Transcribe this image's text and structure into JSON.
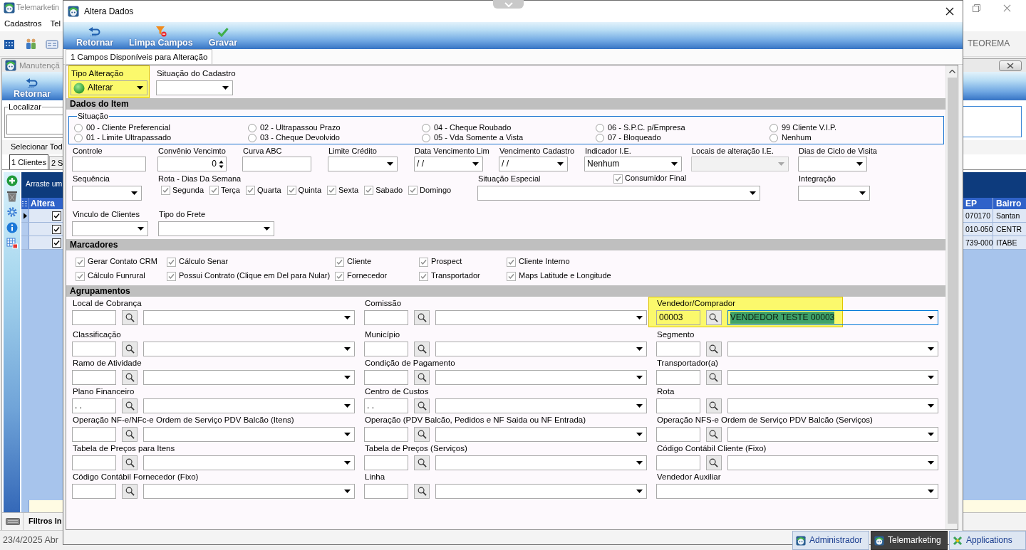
{
  "main_window": {
    "title": "Telemarketin",
    "menu": [
      "Cadastros",
      "Tel"
    ],
    "brand": "TEOREMA"
  },
  "child_window": {
    "title": "Manutençã",
    "toolbar": [
      "Retornar"
    ],
    "search_legend": "Localizar",
    "select_all": "Selecionar Tod",
    "tabs": [
      {
        "label": "1 Clientes",
        "selected": true
      },
      {
        "label": "2 S",
        "selected": false
      }
    ],
    "grid": {
      "group_hint": "Arraste um",
      "check_column": "Altera",
      "columns": [
        "EP",
        "Bairro"
      ],
      "rows": [
        {
          "current": true,
          "altera": true,
          "cells": [
            "070170",
            "Santan"
          ]
        },
        {
          "current": false,
          "altera": true,
          "cells": [
            "010-050",
            "CENTR"
          ]
        },
        {
          "current": false,
          "altera": true,
          "cells": [
            "739-000",
            "ITABE"
          ]
        }
      ]
    },
    "filter_bar": "Filtros In",
    "status": "23/4/2025 Abr"
  },
  "dialog": {
    "title": "Altera Dados",
    "toolbar": [
      "Retornar",
      "Limpa Campos",
      "Gravar"
    ],
    "tabs": [
      {
        "label": "1 Campos Disponíveis para Alteração",
        "selected": true
      }
    ],
    "top_fields": [
      {
        "label": "Tipo Alteração",
        "kind": "status-combo",
        "value": "Alterar",
        "highlighted": true
      },
      {
        "label": "Situação do Cadastro",
        "kind": "combo",
        "highlighted": false
      }
    ],
    "item_section": {
      "header": "Dados do Item",
      "situacao": {
        "legend": "Situação",
        "options": [
          {
            "label": "00 - Cliente Preferencial",
            "selected": false
          },
          {
            "label": "02 - Ultrapassou Prazo",
            "selected": false
          },
          {
            "label": "04 - Cheque Roubado",
            "selected": false
          },
          {
            "label": "06 - S.P.C. p/Empresa",
            "selected": false
          },
          {
            "label": "99 Cliente V.I.P.",
            "selected": false
          },
          {
            "label": "01 - Limite Ultrapassado",
            "selected": false
          },
          {
            "label": "03 - Cheque Devolvido",
            "selected": false
          },
          {
            "label": "05 - Vda Somente a Vista",
            "selected": false
          },
          {
            "label": "07 - Bloqueado",
            "selected": false
          },
          {
            "label": "Nenhum",
            "selected": false
          }
        ]
      },
      "row_1": [
        {
          "label": "Controle",
          "kind": "text"
        },
        {
          "label": "Convênio Vencimto",
          "kind": "spin",
          "value": "0"
        },
        {
          "label": "Curva ABC",
          "kind": "text"
        },
        {
          "label": "Limite Crédito",
          "kind": "combo"
        },
        {
          "label": "Data Vencimento Lim",
          "kind": "combo",
          "value": "/ /"
        },
        {
          "label": "Vencimento Cadastro",
          "kind": "combo",
          "value": "/ /"
        },
        {
          "label": "Indicador I.E.",
          "kind": "combo",
          "value": "Nenhum"
        },
        {
          "label": "Locais de alteração I.E.",
          "kind": "combo",
          "disabled": true
        },
        {
          "label": "Dias de Ciclo de Visita",
          "kind": "combo"
        }
      ],
      "row_2": [
        {
          "label": "Sequência",
          "kind": "combo"
        },
        {
          "label": "Rota - Dias Da Semana",
          "kind": "days",
          "days": [
            {
              "label": "Segunda",
              "checked": true
            },
            {
              "label": "Terça",
              "checked": true
            },
            {
              "label": "Quarta",
              "checked": true
            },
            {
              "label": "Quinta",
              "checked": true
            },
            {
              "label": "Sexta",
              "checked": true
            },
            {
              "label": "Sabado",
              "checked": true
            },
            {
              "label": "Domingo",
              "checked": true
            }
          ]
        },
        {
          "label": "Situação Especial",
          "kind": "combo",
          "option": {
            "label": "Consumidor Final",
            "checked": true
          }
        },
        {
          "label": "Integração",
          "kind": "combo"
        }
      ],
      "row_3": [
        {
          "label": "Vinculo de Clientes",
          "kind": "combo"
        },
        {
          "label": "Tipo do Frete",
          "kind": "combo"
        }
      ]
    },
    "markers": {
      "header": "Marcadores",
      "options": [
        {
          "label": "Gerar Contato CRM",
          "checked": true
        },
        {
          "label": "Cálculo Senar",
          "checked": true
        },
        {
          "label": "Cliente",
          "checked": true
        },
        {
          "label": "Prospect",
          "checked": true
        },
        {
          "label": "Cliente Interno",
          "checked": true
        },
        {
          "label": "Cálculo Funrural",
          "checked": true
        },
        {
          "label": "Possui Contrato (Clique em Del para Nular)",
          "checked": true
        },
        {
          "label": "Fornecedor",
          "checked": true
        },
        {
          "label": "Transportador",
          "checked": true
        },
        {
          "label": "Maps Latitude e Longitude",
          "checked": true
        }
      ]
    },
    "groupings": {
      "header": "Agrupamentos",
      "fields": [
        {
          "label": "Local de Cobrança",
          "kind": "lookup",
          "highlighted": false
        },
        {
          "label": "Comissão",
          "kind": "lookup",
          "highlighted": false
        },
        {
          "label": "Vendedor/Comprador",
          "kind": "lookup",
          "code": "00003",
          "value": "VENDEDOR TESTE 00003",
          "value_selected": true,
          "highlighted": true
        },
        {
          "label": "Classificação",
          "kind": "lookup",
          "highlighted": false
        },
        {
          "label": "Município",
          "kind": "lookup",
          "highlighted": false
        },
        {
          "label": "Segmento",
          "kind": "lookup",
          "highlighted": false
        },
        {
          "label": "Ramo de Atividade",
          "kind": "lookup",
          "highlighted": false
        },
        {
          "label": "Condição de Pagamento",
          "kind": "lookup",
          "highlighted": false
        },
        {
          "label": "Transportador(a)",
          "kind": "lookup",
          "highlighted": false
        },
        {
          "label": "Plano Financeiro",
          "kind": "lookup",
          "code": ". .",
          "highlighted": false
        },
        {
          "label": "Centro de Custos",
          "kind": "lookup",
          "code": ". .",
          "highlighted": false
        },
        {
          "label": "Rota",
          "kind": "lookup",
          "highlighted": false
        },
        {
          "label": "Operação NF-e/NFc-e Ordem de Serviço PDV Balcão (Itens)",
          "kind": "lookup",
          "highlighted": false
        },
        {
          "label": "Operação (PDV Balcão, Pedidos e NF Saida ou NF Entrada)",
          "kind": "lookup",
          "highlighted": false
        },
        {
          "label": "Operação NFS-e Ordem de Serviço PDV Balcão (Serviços)",
          "kind": "lookup",
          "highlighted": false
        },
        {
          "label": "Tabela de Preços para Itens",
          "kind": "lookup",
          "highlighted": false
        },
        {
          "label": "Tabela de Preços (Serviços)",
          "kind": "lookup",
          "highlighted": false
        },
        {
          "label": "Código Contábil Cliente (Fixo)",
          "kind": "lookup",
          "highlighted": false
        },
        {
          "label": "Código Contábil Fornecedor (Fixo)",
          "kind": "lookup",
          "highlighted": false
        },
        {
          "label": "Linha",
          "kind": "lookup",
          "highlighted": false
        },
        {
          "label": "Vendedor Auxiliar",
          "kind": "combo",
          "highlighted": false
        }
      ]
    }
  },
  "taskbar": [
    {
      "label": "Administrador",
      "active": false
    },
    {
      "label": "Telemarketing",
      "active": true
    },
    {
      "label": "Applications",
      "active": false
    }
  ]
}
